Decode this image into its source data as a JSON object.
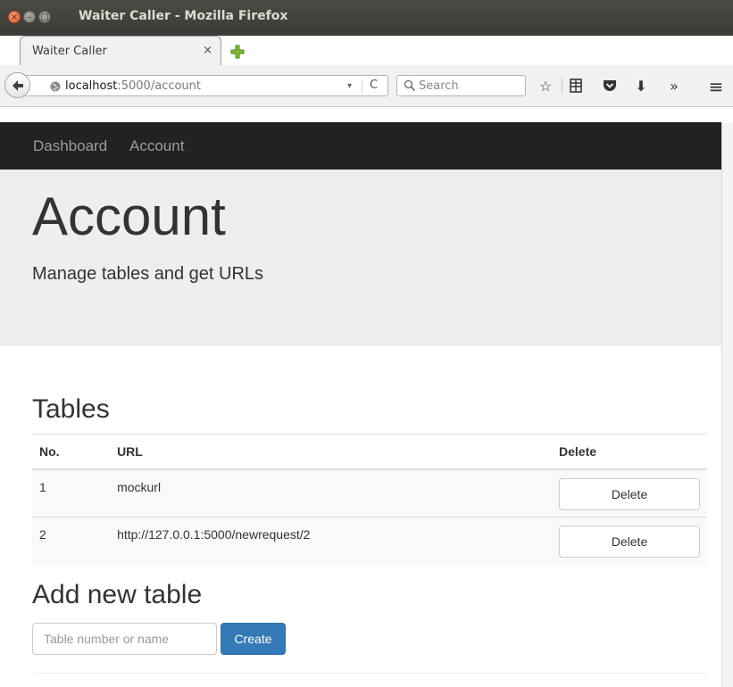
{
  "window": {
    "title": "Waiter Caller - Mozilla Firefox",
    "close_glyph": "×",
    "min_glyph": "–",
    "max_glyph": "□"
  },
  "tab": {
    "label": "Waiter Caller",
    "close_glyph": "×"
  },
  "navbar": {
    "url_host": "localhost",
    "url_rest": ":5000/account",
    "dropdown_glyph": "▾",
    "reload_glyph": "C",
    "search_placeholder": "Search",
    "bookmark_glyph": "☆",
    "library_glyph": "≡",
    "download_glyph": "⬇",
    "overflow_glyph": "»",
    "menu_glyph": "≡"
  },
  "site_nav": {
    "links": [
      "Dashboard",
      "Account"
    ]
  },
  "jumbotron": {
    "title": "Account",
    "subtitle": "Manage tables and get URLs"
  },
  "tables_section": {
    "heading": "Tables",
    "columns": [
      "No.",
      "URL",
      "Delete"
    ],
    "rows": [
      {
        "no": "1",
        "url": "mockurl",
        "action": "Delete"
      },
      {
        "no": "2",
        "url": "http://127.0.0.1:5000/newrequest/2",
        "action": "Delete"
      }
    ]
  },
  "add_section": {
    "heading": "Add new table",
    "input_placeholder": "Table number or name",
    "button_label": "Create"
  },
  "colors": {
    "navbar_dark": "#222222",
    "jumbotron_bg": "#eeeeee",
    "primary_button": "#337ab7",
    "titlebar": "#3c3b37"
  }
}
